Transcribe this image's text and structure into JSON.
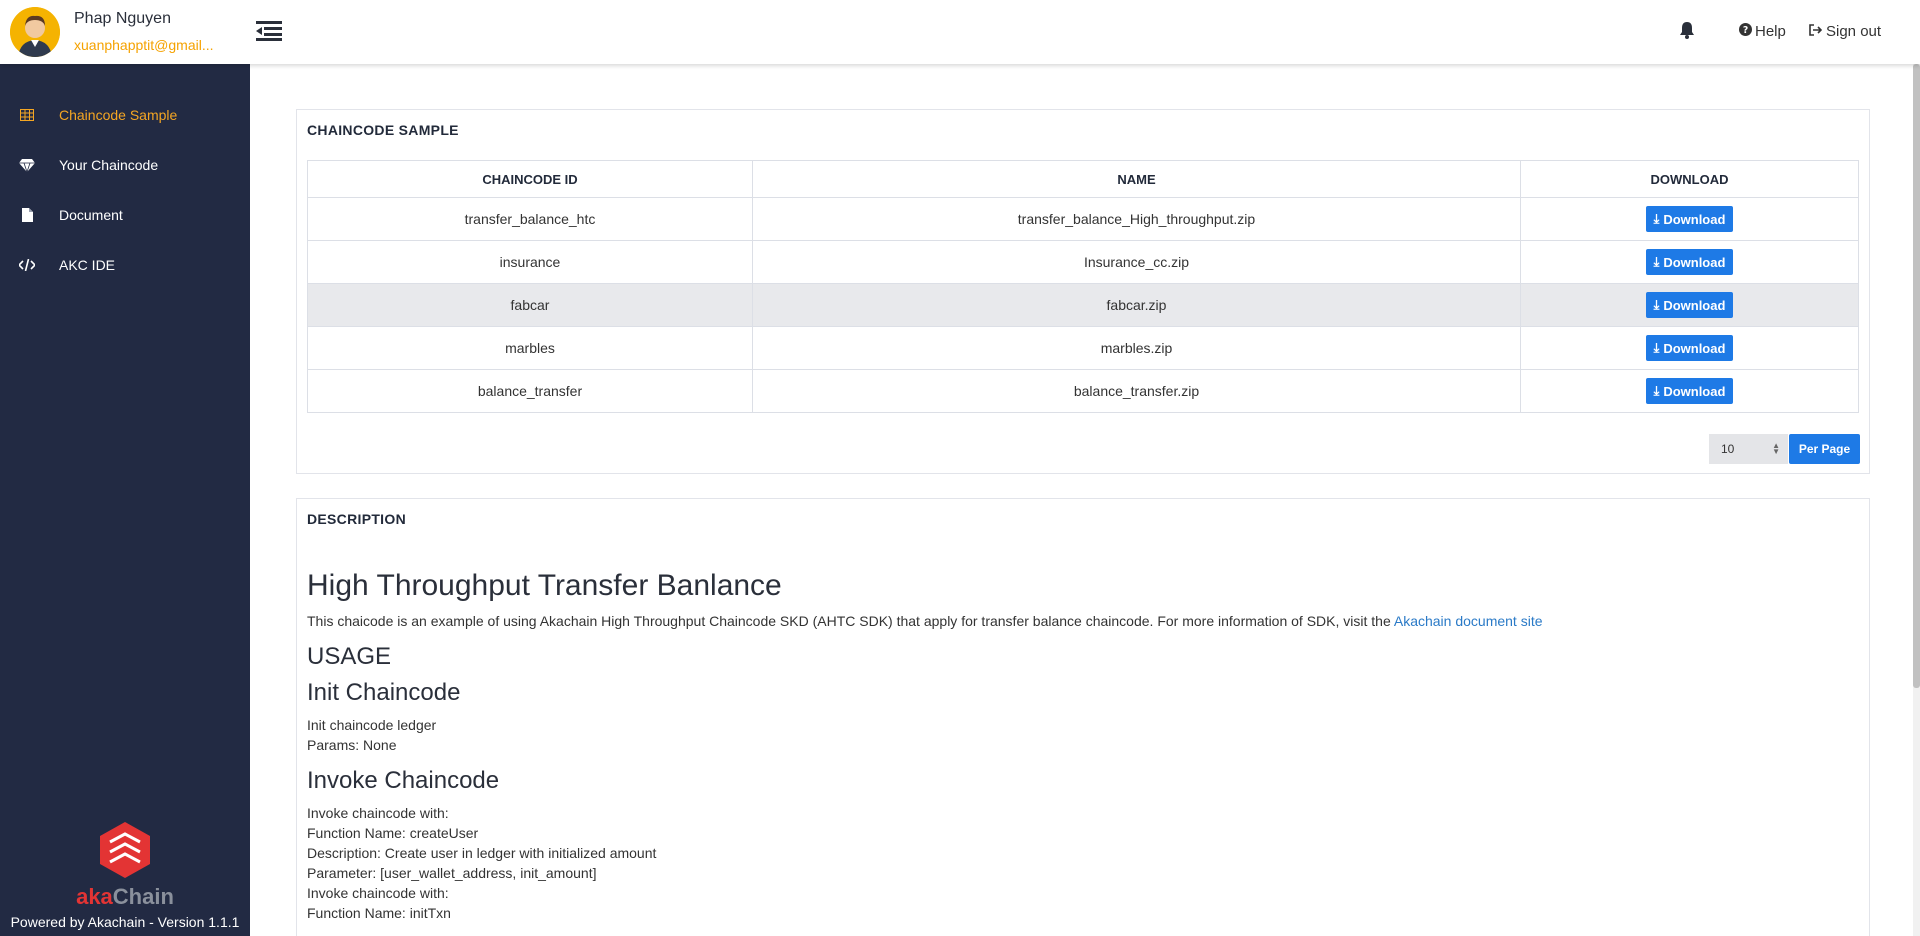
{
  "user": {
    "name": "Phap Nguyen",
    "email": "xuanphapptit@gmail..."
  },
  "header": {
    "help_label": "Help",
    "signout_label": "Sign out"
  },
  "sidebar": {
    "items": [
      {
        "label": "Chaincode Sample",
        "icon": "table-icon",
        "active": true
      },
      {
        "label": "Your Chaincode",
        "icon": "diamond-icon",
        "active": false
      },
      {
        "label": "Document",
        "icon": "file-icon",
        "active": false
      },
      {
        "label": "AKC IDE",
        "icon": "code-icon",
        "active": false
      }
    ],
    "logo_aka": "aka",
    "logo_chain": "Chain",
    "powered_by": "Powered by Akachain - Version 1.1.1"
  },
  "sample_panel": {
    "title": "CHAINCODE SAMPLE",
    "columns": [
      "CHAINCODE ID",
      "NAME",
      "DOWNLOAD"
    ],
    "rows": [
      {
        "id": "transfer_balance_htc",
        "name": "transfer_balance_High_throughput.zip",
        "download": "Download"
      },
      {
        "id": "insurance",
        "name": "Insurance_cc.zip",
        "download": "Download"
      },
      {
        "id": "fabcar",
        "name": "fabcar.zip",
        "download": "Download"
      },
      {
        "id": "marbles",
        "name": "marbles.zip",
        "download": "Download"
      },
      {
        "id": "balance_transfer",
        "name": "balance_transfer.zip",
        "download": "Download"
      }
    ],
    "per_page_value": "10",
    "per_page_label": "Per Page"
  },
  "description_panel": {
    "title": "DESCRIPTION",
    "heading": "High Throughput Transfer Banlance",
    "intro": "This chaicode is an example of using Akachain High Throughput Chaincode SKD (AHTC SDK) that apply for transfer balance chaincode. For more information of SDK, visit the ",
    "link_text": "Akachain document site",
    "usage_heading": "USAGE",
    "init_heading": "Init Chaincode",
    "init_line1": "Init chaincode ledger",
    "init_line2": "Params: None",
    "invoke_heading": "Invoke Chaincode",
    "invoke_line1": "Invoke chaincode with:",
    "invoke_line2": "Function Name: createUser",
    "invoke_line3": "Description: Create user in ledger with initialized amount",
    "invoke_line4": "Parameter: [user_wallet_address, init_amount]",
    "invoke_line5": "Invoke chaincode with:",
    "invoke_line6": "Function Name: initTxn"
  },
  "colors": {
    "sidebar_bg": "#222a43",
    "accent_orange": "#f5a623",
    "button_blue": "#1e7ae6",
    "link_blue": "#2a7ac7",
    "logo_red": "#e33434"
  }
}
